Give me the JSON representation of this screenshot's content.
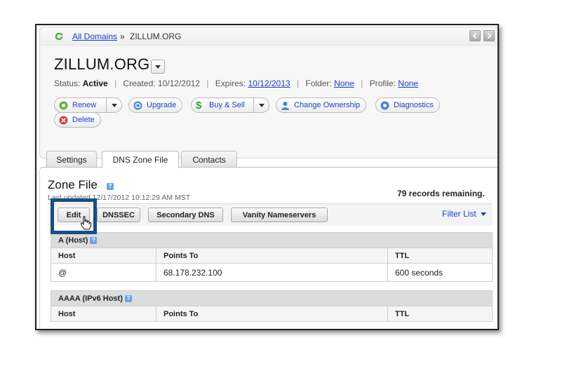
{
  "breadcrumb": {
    "root": "All Domains",
    "separator": "»",
    "current": "ZILLUM.ORG"
  },
  "domain": {
    "name": "ZILLUM.ORG",
    "status_label": "Status:",
    "status_value": "Active",
    "created_label": "Created:",
    "created_value": "10/12/2012",
    "expires_label": "Expires:",
    "expires_value": "10/12/2013",
    "folder_label": "Folder:",
    "folder_value": "None",
    "profile_label": "Profile:",
    "profile_value": "None"
  },
  "actions": {
    "renew": "Renew",
    "upgrade": "Upgrade",
    "buy_sell": "Buy & Sell",
    "change_ownership": "Change Ownership",
    "diagnostics": "Diagnostics",
    "delete": "Delete"
  },
  "tabs": [
    {
      "label": "Settings",
      "active": false
    },
    {
      "label": "DNS Zone File",
      "active": true
    },
    {
      "label": "Contacts",
      "active": false
    }
  ],
  "zone": {
    "title": "Zone File",
    "last_updated": "Last updated 12/17/2012 10:12:29 AM MST",
    "records_remaining": "79 records remaining.",
    "toolbar": {
      "edit": "Edit",
      "dnssec": "DNSSEC",
      "secondary_dns": "Secondary DNS",
      "vanity": "Vanity Nameservers",
      "filter": "Filter List"
    }
  },
  "sections": [
    {
      "title": "A (Host)",
      "columns": [
        "Host",
        "Points To",
        "TTL"
      ],
      "rows": [
        [
          "@",
          "68.178.232.100",
          "600 seconds"
        ]
      ]
    },
    {
      "title": "AAAA (IPv6 Host)",
      "columns": [
        "Host",
        "Points To",
        "TTL"
      ],
      "rows": []
    }
  ],
  "colors": {
    "link": "#1a3fc7",
    "highlight": "#184e86",
    "renew": "#6ab43e",
    "delete": "#d64040",
    "buy": "#3aa13a",
    "info": "#4a86d6"
  },
  "icons": {
    "refresh": "refresh-icon",
    "renew": "renew-icon",
    "upgrade": "upgrade-icon",
    "buy_sell": "dollar-icon",
    "owner": "user-icon",
    "diagnostics": "diagnostics-icon",
    "delete": "delete-icon",
    "help": "help-icon",
    "cursor": "hand-cursor-icon"
  }
}
